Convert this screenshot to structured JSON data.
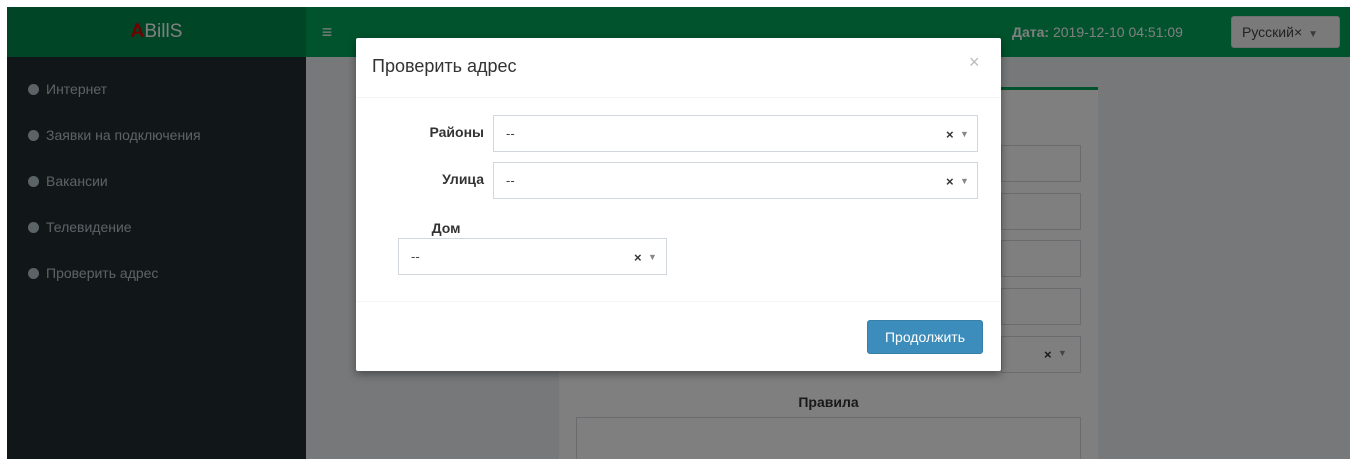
{
  "header": {
    "logo_prefix": "A",
    "logo_rest": "BillS",
    "date_label": "Дата:",
    "date_value": "2019-12-10 04:51:09",
    "language": "Русский×",
    "hamburger": "≡",
    "accent_color": "#00a65a"
  },
  "sidebar": {
    "items": [
      {
        "label": "Интернет"
      },
      {
        "label": "Заявки на подключения"
      },
      {
        "label": "Вакансии"
      },
      {
        "label": "Телевидение"
      },
      {
        "label": "Проверить адрес"
      }
    ]
  },
  "background_form": {
    "select_clear": "×",
    "rules_label": "Правила"
  },
  "modal": {
    "title": "Проверить адрес",
    "close": "×",
    "fields": [
      {
        "label": "Районы",
        "value": "--",
        "clear": "×",
        "arrow": "▼"
      },
      {
        "label": "Улица",
        "value": "--",
        "clear": "×",
        "arrow": "▼"
      },
      {
        "label": "Дом",
        "value": "--",
        "clear": "×",
        "arrow": "▼"
      }
    ],
    "continue_label": "Продолжить",
    "button_color": "#3c8dbc"
  }
}
